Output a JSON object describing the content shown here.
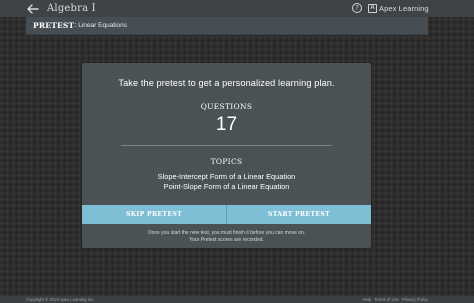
{
  "topbar": {
    "course_title": "Algebra I",
    "help_symbol": "?",
    "brand_mark": "A",
    "brand_name": "Apex Learning"
  },
  "subbar": {
    "label": "PRETEST",
    "colon": ":",
    "activity_name": "Linear Equations"
  },
  "pretest": {
    "headline": "Take the pretest to get a personalized learning plan.",
    "questions_label": "QUESTIONS",
    "questions_count": "17",
    "topics_label": "TOPICS",
    "topics": [
      "Slope-Intercept Form of a Linear Equation",
      "Point-Slope Form of a Linear Equation"
    ],
    "skip_label": "SKIP PRETEST",
    "start_label": "START PRETEST",
    "note_line1": "Once you start the new test, you must finish it before you can move on.",
    "note_line2": "Your Pretest scores are recorded."
  },
  "footer": {
    "copyright": "Copyright © 2019 Apex Learning Inc.",
    "links": [
      "Help",
      "Terms of Use",
      "Privacy Policy"
    ]
  },
  "colors": {
    "page_bg": "#2e2e2e",
    "topbar_bg": "#3d4347",
    "subbar_bg": "#474e53",
    "card_bg": "#4a5256",
    "button_bg": "#7fbfd6"
  },
  "icons": {
    "back": "back-arrow-icon",
    "help": "help-icon",
    "brand": "apex-logo-icon"
  }
}
